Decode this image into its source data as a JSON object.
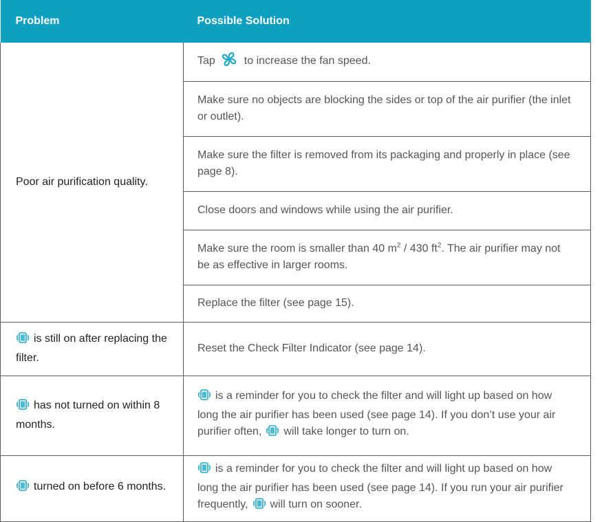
{
  "header": {
    "col1": "Problem",
    "col2": "Possible Solution"
  },
  "colors": {
    "header_bg": "#0f9fc0",
    "accent_icon": "#1fa9c8",
    "border": "#5c5c5c"
  },
  "icons": {
    "fan": "fan-icon",
    "filter": "check-filter-icon"
  },
  "rows": [
    {
      "problem": "Poor air purification quality.",
      "solutions": {
        "s0": {
          "pre": "Tap",
          "post": "to increase the fan speed."
        },
        "s1": "Make sure no objects are blocking the sides or top of the air purifier (the inlet or outlet).",
        "s2": "Make sure the filter is removed from its packaging and properly in place (see page 8).",
        "s3": "Close doors and windows while using the air purifier.",
        "s4": {
          "pre": "Make sure the room is smaller than 40 m",
          "sup1": "2",
          "mid": " / 430 ft",
          "sup2": "2",
          "post": ". The air purifier may not be as effective in larger rooms."
        },
        "s5": "Replace the filter (see page 15)."
      }
    },
    {
      "problem": "is still on after replacing the filter.",
      "solution": "Reset the Check Filter Indicator (see page 14)."
    },
    {
      "problem": "has not turned on within 8 months.",
      "solution": {
        "a": "is a reminder for you to check the filter and will light up based on how long the air purifier has been used (see page 14). If you don’t use your air purifier often,",
        "b": "will take longer to turn on."
      }
    },
    {
      "problem": "turned on before 6 months.",
      "solution": {
        "a": "is a reminder for you to check the filter and will light up based on how long the air purifier has been used (see page 14). If you run your air purifier frequently,",
        "b": "will turn on sooner."
      }
    }
  ]
}
